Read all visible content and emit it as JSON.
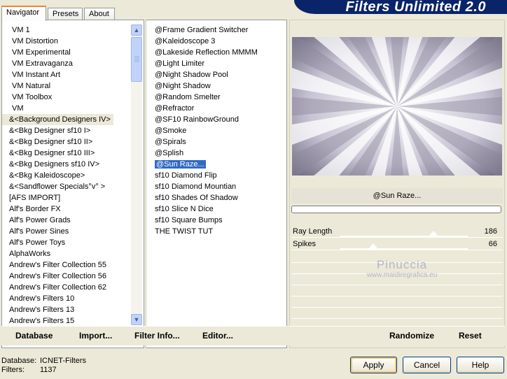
{
  "tabs": [
    {
      "label": "Navigator"
    },
    {
      "label": "Presets"
    },
    {
      "label": "About"
    }
  ],
  "banner": {
    "title": "Filters Unlimited 2.0"
  },
  "categories": [
    "VM 1",
    "VM Distortion",
    "VM Experimental",
    "VM Extravaganza",
    "VM Instant Art",
    "VM Natural",
    "VM Toolbox",
    "VM",
    "&<Background Designers IV>",
    "&<Bkg Designer sf10 I>",
    "&<Bkg Designer sf10 II>",
    "&<Bkg Designer sf10 III>",
    "&<Bkg Designers sf10 IV>",
    "&<Bkg Kaleidoscope>",
    "&<Sandflower Specials°v° >",
    "[AFS IMPORT]",
    "Alf's Border FX",
    "Alf's Power Grads",
    "Alf's Power Sines",
    "Alf's Power Toys",
    "AlphaWorks",
    "Andrew's Filter Collection 55",
    "Andrew's Filter Collection 56",
    "Andrew's Filter Collection 62",
    "Andrew's Filters 10",
    "Andrew's Filters 13",
    "Andrew's Filters 15"
  ],
  "selected_category": "&<Background Designers IV>",
  "filters": [
    "@Frame Gradient Switcher",
    "@Kaleidoscope 3",
    "@Lakeside Reflection MMMM",
    "@Light Limiter",
    "@Night Shadow Pool",
    "@Night Shadow",
    "@Random Smelter",
    "@Refractor",
    "@SF10 RainbowGround",
    "@Smoke",
    "@Spirals",
    "@Splish",
    "@Sun Raze...",
    "sf10 Diamond Flip",
    "sf10 Diamond Mountian",
    "sf10 Shades Of Shadow",
    "sf10 Slice N Dice",
    "sf10 Square Bumps",
    "THE TWIST TUT"
  ],
  "selected_filter": "@Sun Raze...",
  "preview": {
    "filter_name": "@Sun Raze...",
    "sliders": [
      {
        "label": "Ray Length",
        "value": "186",
        "level": 0.73
      },
      {
        "label": "Spikes",
        "value": "66",
        "level": 0.26
      }
    ],
    "watermark_name": "Pinuccia",
    "watermark_url": "www.maidiregrafica.eu"
  },
  "commands_left": {
    "database": "Database",
    "import": "Import...",
    "filter_info": "Filter Info...",
    "editor": "Editor..."
  },
  "commands_right": {
    "randomize": "Randomize",
    "reset": "Reset"
  },
  "status": {
    "database_label": "Database:",
    "database_value": "ICNET-Filters",
    "filters_label": "Filters:",
    "filters_value": "1137"
  },
  "buttons": {
    "apply": "Apply",
    "cancel": "Cancel",
    "help": "Help"
  },
  "colors": {
    "selection": "#316ac5",
    "banner": "#0a246a",
    "accent": "#e68b2c"
  }
}
